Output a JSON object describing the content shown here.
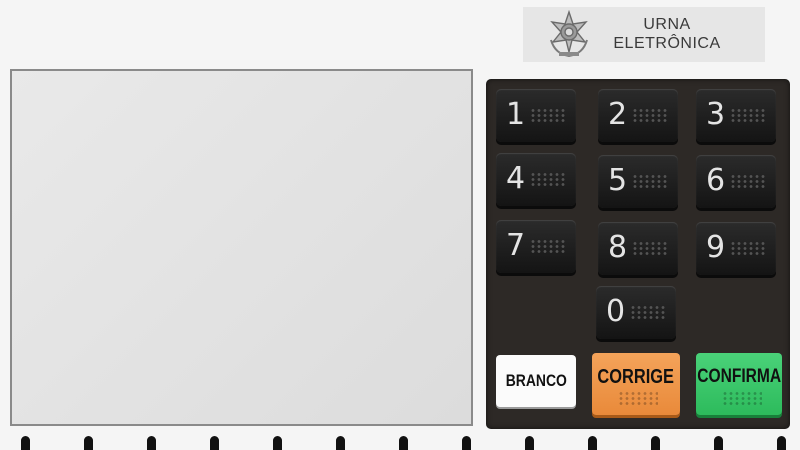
{
  "brand": {
    "title_line1": "URNA",
    "title_line2": "ELETRÔNICA",
    "emblem_icon": "brazil-coat-of-arms"
  },
  "screen": {
    "content": ""
  },
  "keypad": {
    "keys": [
      {
        "digit": "1"
      },
      {
        "digit": "2"
      },
      {
        "digit": "3"
      },
      {
        "digit": "4"
      },
      {
        "digit": "5"
      },
      {
        "digit": "6"
      },
      {
        "digit": "7"
      },
      {
        "digit": "8"
      },
      {
        "digit": "9"
      },
      {
        "digit": "0"
      }
    ],
    "actions": {
      "branco": "BRANCO",
      "corrige": "CORRIGE",
      "confirma": "CONFIRMA"
    }
  },
  "colors": {
    "keypad_bg": "#2d2926",
    "branco": "#fbfbfb",
    "corrige": "#ef9544",
    "confirma": "#35c463"
  }
}
